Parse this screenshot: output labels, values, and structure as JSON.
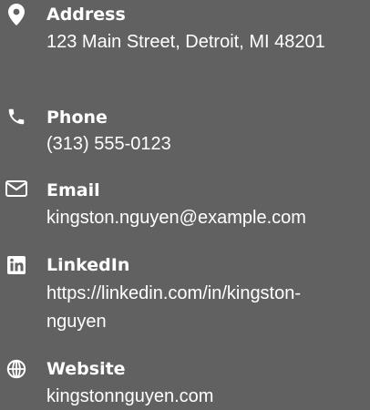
{
  "contacts": {
    "address": {
      "icon": "map-marker-icon",
      "label": "Address",
      "value": "123 Main Street, Detroit, MI 48201"
    },
    "phone": {
      "icon": "phone-icon",
      "label": "Phone",
      "value": "(313) 555-0123"
    },
    "email": {
      "icon": "envelope-icon",
      "label": "Email",
      "value": "kingston.nguyen@example.com"
    },
    "linkedin": {
      "icon": "linkedin-icon",
      "label": "LinkedIn",
      "value_line1": "https://linkedin.com/in/kingston-",
      "value_line2": "nguyen"
    },
    "website": {
      "icon": "globe-icon",
      "label": "Website",
      "value": "kingstonnguyen.com"
    }
  },
  "colors": {
    "background": "#616161",
    "text": "#ffffff"
  }
}
